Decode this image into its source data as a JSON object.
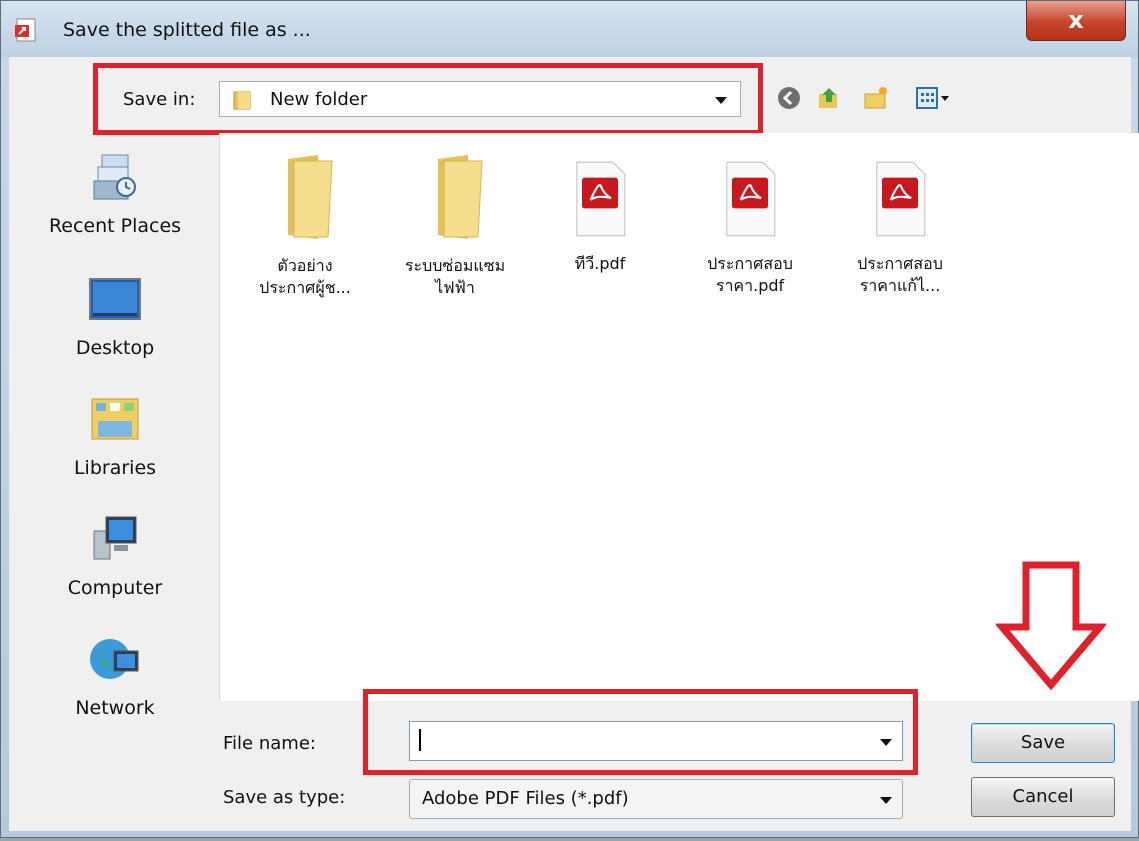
{
  "window": {
    "title": "Save the splitted file as ...",
    "close_label": "x"
  },
  "savein": {
    "label": "Save in:",
    "value": "New folder"
  },
  "places": [
    {
      "label": "Recent Places",
      "icon": "recent-places-icon"
    },
    {
      "label": "Desktop",
      "icon": "desktop-icon"
    },
    {
      "label": "Libraries",
      "icon": "libraries-icon"
    },
    {
      "label": "Computer",
      "icon": "computer-icon"
    },
    {
      "label": "Network",
      "icon": "network-icon"
    }
  ],
  "files": [
    {
      "line1": "ตัวอย่าง",
      "line2": "ประกาศผู้ช...",
      "type": "folder"
    },
    {
      "line1": "ระบบซ่อมแซม",
      "line2": "ไฟฟ้า",
      "type": "folder"
    },
    {
      "line1": "ทีวี.pdf",
      "line2": "",
      "type": "pdf"
    },
    {
      "line1": "ประกาศสอบ",
      "line2": "ราคา.pdf",
      "type": "pdf"
    },
    {
      "line1": "ประกาศสอบ",
      "line2": "ราคาแก้ไ...",
      "type": "pdf"
    }
  ],
  "filename": {
    "label": "File name:",
    "value": ""
  },
  "savetype": {
    "label": "Save as type:",
    "value": "Adobe PDF Files (*.pdf)"
  },
  "buttons": {
    "save": "Save",
    "cancel": "Cancel"
  },
  "colors": {
    "annotation": "#e0202a",
    "pdf_red": "#c8171d",
    "folder_yellow": "#f1d36a"
  }
}
